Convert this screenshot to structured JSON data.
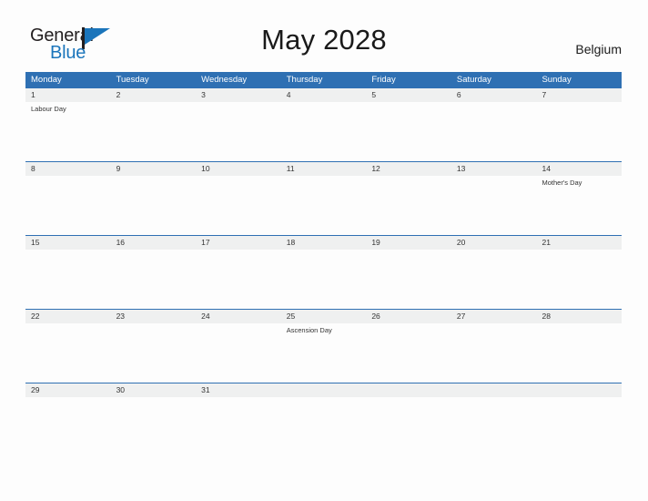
{
  "logo": {
    "word_top": "General",
    "word_bottom": "Blue",
    "mark": "blue-flag-triangle",
    "color_dark": "#231f20",
    "color_blue": "#1b75bb"
  },
  "header": {
    "title": "May 2028",
    "country": "Belgium"
  },
  "theme": {
    "header_blue": "#2f70b3",
    "date_band_gray": "#eff0f0",
    "page_background": "#fdfdfd",
    "text_dark": "#333333"
  },
  "calendar": {
    "weekdays": [
      "Monday",
      "Tuesday",
      "Wednesday",
      "Thursday",
      "Friday",
      "Saturday",
      "Sunday"
    ],
    "weeks": [
      {
        "days": [
          {
            "date": "1",
            "events": [
              "Labour Day"
            ]
          },
          {
            "date": "2",
            "events": []
          },
          {
            "date": "3",
            "events": []
          },
          {
            "date": "4",
            "events": []
          },
          {
            "date": "5",
            "events": []
          },
          {
            "date": "6",
            "events": []
          },
          {
            "date": "7",
            "events": []
          }
        ]
      },
      {
        "days": [
          {
            "date": "8",
            "events": []
          },
          {
            "date": "9",
            "events": []
          },
          {
            "date": "10",
            "events": []
          },
          {
            "date": "11",
            "events": []
          },
          {
            "date": "12",
            "events": []
          },
          {
            "date": "13",
            "events": []
          },
          {
            "date": "14",
            "events": [
              "Mother's Day"
            ]
          }
        ]
      },
      {
        "days": [
          {
            "date": "15",
            "events": []
          },
          {
            "date": "16",
            "events": []
          },
          {
            "date": "17",
            "events": []
          },
          {
            "date": "18",
            "events": []
          },
          {
            "date": "19",
            "events": []
          },
          {
            "date": "20",
            "events": []
          },
          {
            "date": "21",
            "events": []
          }
        ]
      },
      {
        "days": [
          {
            "date": "22",
            "events": []
          },
          {
            "date": "23",
            "events": []
          },
          {
            "date": "24",
            "events": []
          },
          {
            "date": "25",
            "events": [
              "Ascension Day"
            ]
          },
          {
            "date": "26",
            "events": []
          },
          {
            "date": "27",
            "events": []
          },
          {
            "date": "28",
            "events": []
          }
        ]
      },
      {
        "days": [
          {
            "date": "29",
            "events": []
          },
          {
            "date": "30",
            "events": []
          },
          {
            "date": "31",
            "events": []
          },
          {
            "date": "",
            "events": []
          },
          {
            "date": "",
            "events": []
          },
          {
            "date": "",
            "events": []
          },
          {
            "date": "",
            "events": []
          }
        ]
      }
    ]
  }
}
